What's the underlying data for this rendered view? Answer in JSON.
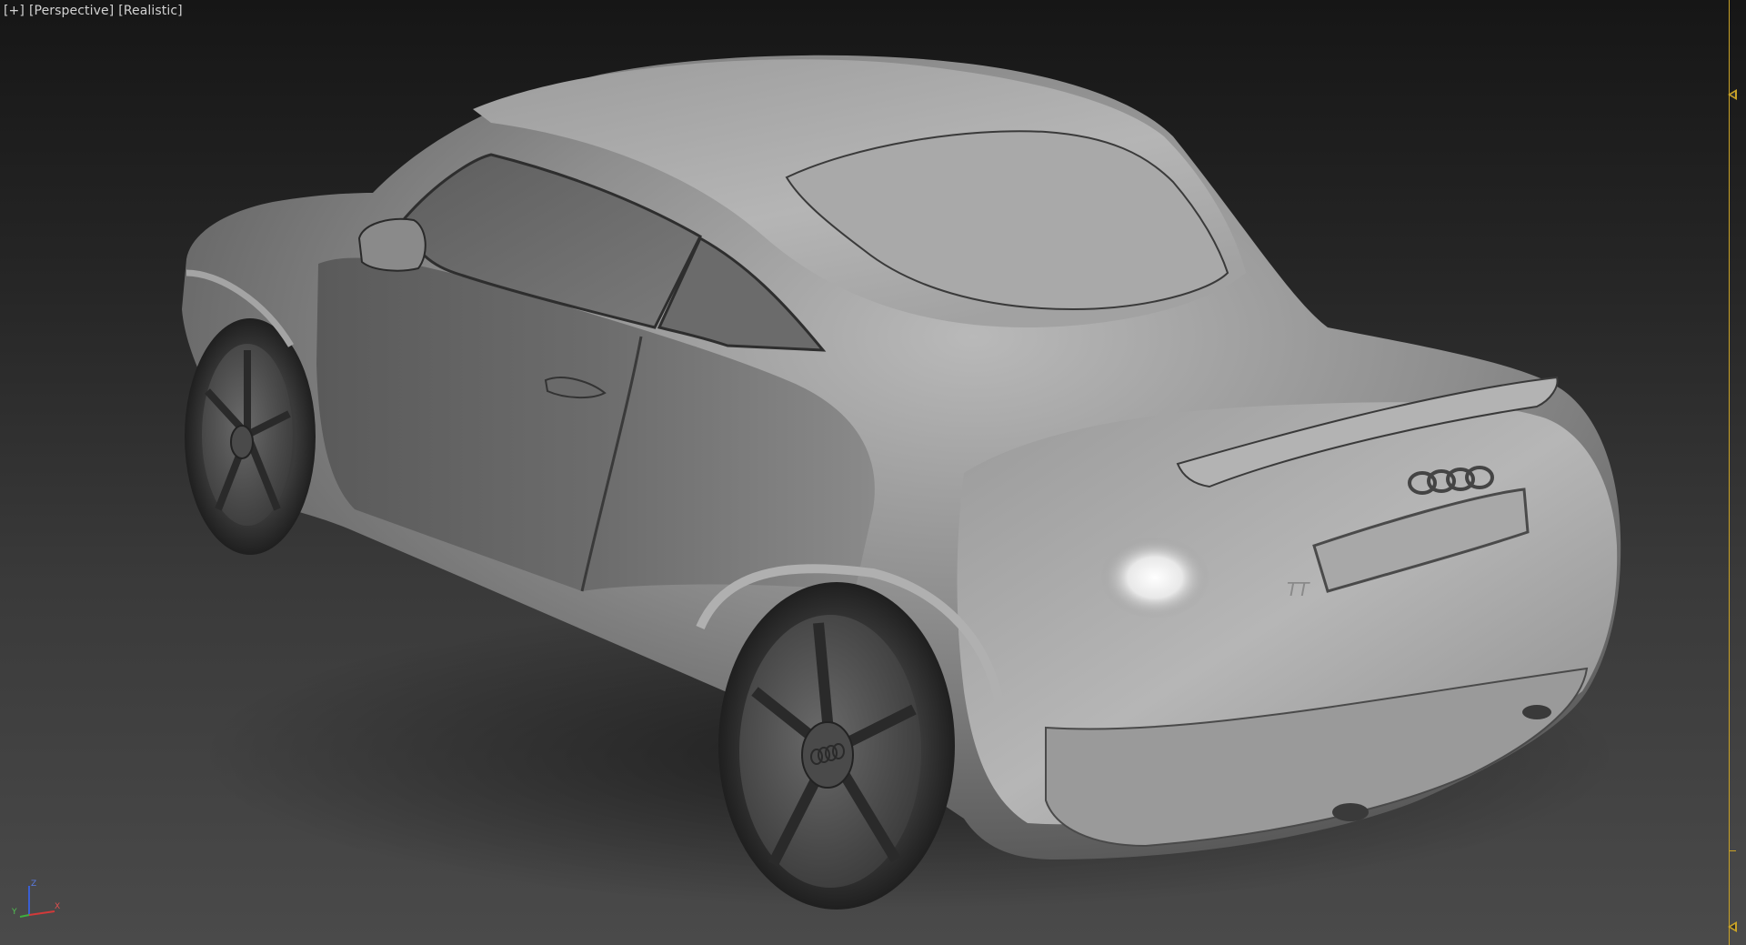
{
  "viewport": {
    "label_plus": "[+]",
    "label_view": "[Perspective]",
    "label_shading": "[Realistic]"
  },
  "axis_gizmo": {
    "z_label": "Z",
    "x_label": "X",
    "y_label": "Y",
    "colors": {
      "x": "#d23a3a",
      "y": "#3fae3f",
      "z": "#3a5fd2"
    }
  },
  "scene": {
    "object": "car-model",
    "badge_text": "TT"
  },
  "colors": {
    "safe_frame": "#c9a227",
    "viewport_top": "#161616",
    "viewport_bottom": "#4a4a4a"
  }
}
